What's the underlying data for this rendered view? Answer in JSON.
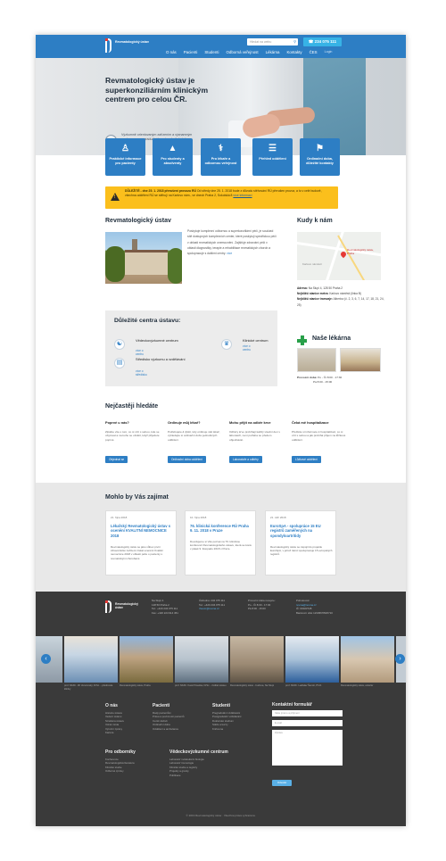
{
  "header": {
    "logo_text": "Revmatologický ústav",
    "search_placeholder": "Hledat na webu",
    "phone": "234 075 111",
    "nav": [
      "O nás",
      "Pacienti",
      "Studenti",
      "Odborná veřejnost",
      "Lékárna",
      "Kontakty",
      "ČES",
      "Login"
    ]
  },
  "hero": {
    "title": "Revmatologický ústav je superkonziliárním klinickým centrem pro celou ČR.",
    "subtitle": "Výzkumně orientovaným zařízením a významným centrem pro pregraduální i postgraduální výuku."
  },
  "tiles": [
    {
      "label": "Praktické informace pro pacienty",
      "icon": "patient-icon"
    },
    {
      "label": "Pro studenty a absolventy",
      "icon": "graduation-cap-icon"
    },
    {
      "label": "Pro lékaře a odbornou veřejnost",
      "icon": "doctor-icon"
    },
    {
      "label": "Přehled oddělení",
      "icon": "document-icon"
    },
    {
      "label": "Ordinační doba, důležité kontakty",
      "icon": "map-icon"
    }
  ],
  "notice": {
    "bold": "DŮLEŽITÉ - dne 25. 1. 2018 přerušení provozu RÚ",
    "text": "Od středy dne 25. 1. 2018 bude z důvodu stěhování RÚ přerušen provoz, a to v celé budově, všechna oddělení RÚ se stěhují na Karlovo nám., ve dnech Praha 2, Sokolská 8",
    "link": "více informací"
  },
  "institute": {
    "heading": "Revmatologický ústav",
    "text": "Poskytuje komplexní odbornou a superkonziliární péči, je součástí sítě dostupných komplexních center, které poskytují specifickou péči v oblasti revmatických onemocnění. Zajišťuje zdravotní péči v oblasti diagnostiky, terapie a rehabilitace revmatických chorob a spolupracuje s dalšími centry.",
    "more": "více"
  },
  "centers": {
    "heading": "Důležité centra ústavu:",
    "items": [
      {
        "name": "Vědeckovýzkumné centrum",
        "more": "více o centru",
        "icon": "microscope-icon"
      },
      {
        "name": "Klinické centrum",
        "more": "více o centru",
        "icon": "medical-person-icon"
      },
      {
        "name": "Středisko výzkumu a vzdělávání",
        "more": "více o středisku",
        "icon": "book-icon"
      }
    ]
  },
  "location": {
    "heading": "Kudy k nám",
    "map_label": "Revmatologický ústav, Praha",
    "map_place": "Karlovo náměstí",
    "address_label": "Adresa:",
    "address": "Na Slupi 4, 128 50 Praha 2",
    "metro_label": "Nejbližší stanice metra:",
    "metro": "Karlovo náměstí (linka B)",
    "tram_label": "Nejbližší stanice tramvaje:",
    "tram": "Albertov (č. 2, 3, 6, 7, 14, 17, 18, 21, 24, 25)"
  },
  "pharmacy": {
    "heading": "Naše lékárna",
    "hours_label": "Provozní doba:",
    "hours1": "Po - Čt    8:00 - 17:30",
    "hours2": "Pá           8:00 - 15:00"
  },
  "faq": {
    "heading": "Nejčastěji hledáte",
    "items": [
      {
        "q": "Poprvé u nás?",
        "a": "Zjistěte vše o tom, co si vzít s sebou, kde se ubytovat a na koho se obrátit, když přijedete poprvé.",
        "btn": "Objednat se"
      },
      {
        "q": "Ordinuje můj lékař?",
        "a": "Potřebujete-li zjistit, kdy ordinuje váš lékař, vyhledejte si ordinační dobu jednotlivých oddělení.",
        "btn": "Ordinační doba oddělení"
      },
      {
        "q": "Mohu přijít na odběr krve",
        "a": "Odběry krve probíhají každý všední den v laboratoři, není potřeba se předem objednávat.",
        "btn": "Laboratoře a odběry"
      },
      {
        "q": "Čeká mě hospitalizace",
        "a": "Přečtěte si informace k hospitalizaci, co si vzít s sebou a jak probíhá příjem na lůžkové oddělení.",
        "btn": "Lůžkové oddělení"
      }
    ]
  },
  "interest": {
    "heading": "Mohlo by Vás zajímat",
    "cards": [
      {
        "date": "21. října 2018",
        "title": "Lékařský Revmatologický ústav s ocenění KVALITNÍ NEMOCNICE 2018",
        "text": "Revmatologický ústav se jako vůbec první zdravotnické zařízení získal ocenění Kvalitní nemocnice 2018 v oblasti péče o pacienty s revmatickými chorobami."
      },
      {
        "date": "10. října 2018",
        "title": "76. klinická konference RÚ Praha 9. 11. 2018 v Praze",
        "text": "Dovolujeme si Vás pozvat na 76. klinickou konferenci Revmatologického ústavu, která se koná v pátek 9. listopadu 2018 v Praze."
      },
      {
        "date": "21. září 2018",
        "title": "EuroSpA - spolupráce 15 EU registrů zaměřených na spondyloartritidy",
        "text": "Revmatologický ústav se zapojil do projektu EuroSpA, v jehož rámci spolupracuje 15 evropských registrů."
      }
    ]
  },
  "footer": {
    "logo_text": "Revmatologický ústav",
    "col1": [
      "Na Slupi 4",
      "128 50 Praha 2",
      "Tel.: +420 234 075 111",
      "Fax: +420 224 914 451"
    ],
    "col2": [
      "Ústředna: 234 075 111",
      "Tel.: +420 234 075 111",
      "rheum@revma.cz"
    ],
    "col3": [
      "Provozní doba recepce:",
      "Po - Čt     8:00 - 17:30",
      "Pá            8:00 - 15:00"
    ],
    "col4": [
      "Pohotovost:",
      "revma@revma.cz",
      "IČ: 00023728",
      "Bankovní účet 123456789/0710"
    ],
    "gallery": [
      {
        "caption": "prof. MUDr. Jiří Vencovský, DrSc. - přednosta kliniky"
      },
      {
        "caption": "Revmatologický ústav, Praha"
      },
      {
        "caption": "prof. MUDr. Karel Pavelka, DrSc. - ředitel ústavu"
      },
      {
        "caption": "Revmatologický ústav - budova, Na Slupi"
      },
      {
        "caption": "prof. MUDr. Ladislav Šenolt, Ph.D."
      },
      {
        "caption": "Revmatologický ústav, exteriér"
      }
    ],
    "links": {
      "o_nas": {
        "title": "O nás",
        "items": [
          "Historie ústavu",
          "Vedení ústavu",
          "Struktura ústavu",
          "Volná místa",
          "Výroční zprávy",
          "Kariéra"
        ]
      },
      "pacienti": {
        "title": "Pacienti",
        "items": [
          "Rady pacientům",
          "Práva a povinnosti pacientů",
          "Ceník služeb",
          "Ordinační doba",
          "Oddělení a ambulance"
        ]
      },
      "studenti": {
        "title": "Studenti",
        "items": [
          "Pregraduální vzdělávání",
          "Postgraduální vzdělávání",
          "Doktorské studium",
          "Stáže a kurzy",
          "Knihovna"
        ]
      },
      "odbornici": {
        "title": "Pro odborníky",
        "items": [
          "Konference",
          "Revmatologická literatura",
          "Klinické studie",
          "Odborné zprávy"
        ]
      },
      "vedecke": {
        "title": "Vědeckovýzkumné centrum",
        "items": [
          "Laboratoř molekulární biologie",
          "Laboratoř imunologie",
          "Klinické studie a registry",
          "Projekty a granty",
          "Publikace"
        ]
      }
    },
    "form": {
      "title": "Kontaktní formulář",
      "name": "Vaše jméno a příjmení",
      "email": "E-mail",
      "message": "Zpráva",
      "submit": "Odeslat"
    },
    "copyright": "© 2019 Revmatologický ústav · Všechna práva vyhrazena."
  }
}
